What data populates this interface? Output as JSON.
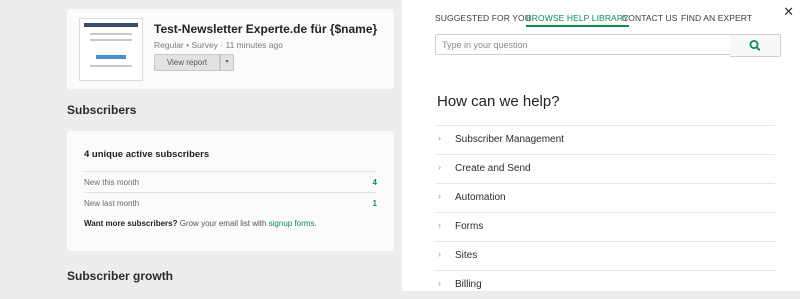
{
  "campaign": {
    "title": "Test-Newsletter Experte.de für {$name}",
    "meta": "Regular • Survey · 11 minutes ago",
    "view_report": "View report",
    "caret": "▾"
  },
  "subscribers": {
    "section_title": "Subscribers",
    "heading": "4 unique active subscribers",
    "rows": [
      {
        "label": "New this month",
        "value": "4"
      },
      {
        "label": "New last month",
        "value": "1"
      }
    ],
    "cta_bold": "Want more subscribers?",
    "cta_text": " Grow your email list with ",
    "cta_link": "signup forms",
    "cta_end": "."
  },
  "growth": {
    "section_title": "Subscriber growth"
  },
  "help": {
    "close": "✕",
    "tabs": [
      "SUGGESTED FOR YOU",
      "BROWSE HELP LIBRARY",
      "CONTACT US",
      "FIND AN EXPERT"
    ],
    "active_tab": "BROWSE HELP LIBRARY",
    "search_placeholder": "Type in your question",
    "heading": "How can we help?",
    "topics": [
      "Subscriber Management",
      "Create and Send",
      "Automation",
      "Forms",
      "Sites",
      "Billing"
    ]
  },
  "colors": {
    "accent": "#0d8a52",
    "panel_bg": "#ffffff",
    "page_bg": "#ededed"
  }
}
